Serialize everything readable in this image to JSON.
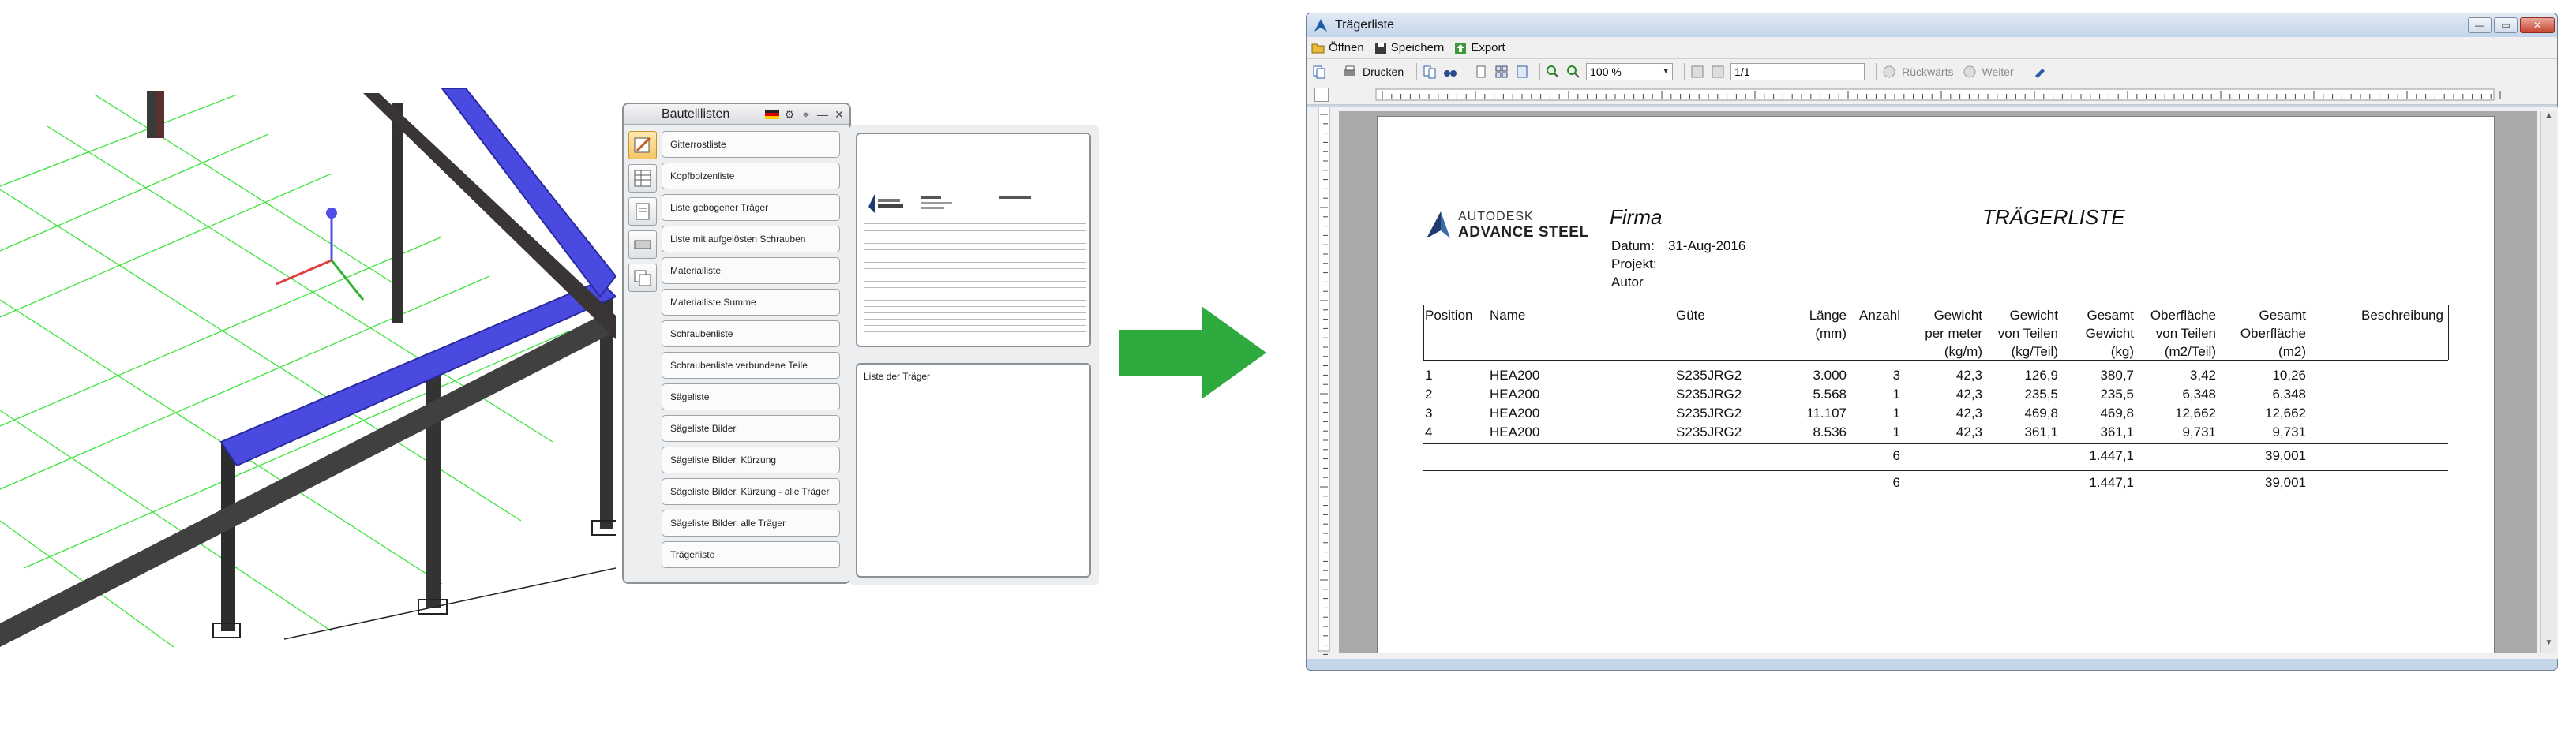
{
  "palette": {
    "title": "Bauteillisten",
    "items": [
      "Gitterrostliste",
      "Kopfbolzenliste",
      "Liste gebogener Träger",
      "Liste mit aufgelösten Schrauben",
      "Materialliste",
      "Materialliste Summe",
      "Schraubenliste",
      "Schraubenliste verbundene Teile",
      "Sägeliste",
      "Sägeliste Bilder",
      "Sägeliste Bilder, Kürzung",
      "Sägeliste Bilder, Kürzung - alle Träger",
      "Sägeliste Bilder, alle Träger",
      "Trägerliste"
    ],
    "description_title": "Liste der Träger"
  },
  "window": {
    "title": "Trägerliste",
    "menu": {
      "open": "Öffnen",
      "save": "Speichern",
      "export": "Export"
    },
    "toolbar": {
      "print": "Drucken",
      "zoom": "100 %",
      "page": "1/1",
      "back": "Rückwärts",
      "forward": "Weiter"
    }
  },
  "report": {
    "logo_line1": "AUTODESK",
    "logo_line2": "ADVANCE STEEL",
    "firma": "Firma",
    "title": "TRÄGERLISTE",
    "datum_label": "Datum:",
    "datum_value": "31-Aug-2016",
    "projekt_label": "Projekt:",
    "autor_label": "Autor",
    "columns": {
      "position": "Position",
      "name": "Name",
      "guete": "Güte",
      "laenge": [
        "Länge",
        "(mm)"
      ],
      "anzahl": "Anzahl",
      "gewicht_m": [
        "Gewicht",
        "per meter",
        "(kg/m)"
      ],
      "gewicht_teil": [
        "Gewicht",
        "von Teilen",
        "(kg/Teil)"
      ],
      "gesamt_gewicht": [
        "Gesamt",
        "Gewicht",
        "(kg)"
      ],
      "oberflaeche": [
        "Oberfläche",
        "von Teilen",
        "(m2/Teil)"
      ],
      "gesamt_oberflaeche": [
        "Gesamt",
        "Oberfläche",
        "(m2)"
      ],
      "beschreibung": "Beschreibung"
    },
    "rows": [
      [
        "1",
        "HEA200",
        "S235JRG2",
        "3.000",
        "3",
        "42,3",
        "126,9",
        "380,7",
        "3,42",
        "10,26"
      ],
      [
        "2",
        "HEA200",
        "S235JRG2",
        "5.568",
        "1",
        "42,3",
        "235,5",
        "235,5",
        "6,348",
        "6,348"
      ],
      [
        "3",
        "HEA200",
        "S235JRG2",
        "11.107",
        "1",
        "42,3",
        "469,8",
        "469,8",
        "12,662",
        "12,662"
      ],
      [
        "4",
        "HEA200",
        "S235JRG2",
        "8.536",
        "1",
        "42,3",
        "361,1",
        "361,1",
        "9,731",
        "9,731"
      ]
    ],
    "subtotal": {
      "anzahl": "6",
      "gewicht": "1.447,1",
      "oberflaeche": "39,001"
    },
    "total": {
      "anzahl": "6",
      "gewicht": "1.447,1",
      "oberflaeche": "39,001"
    }
  },
  "colors": {
    "arrow": "#2eaa3e",
    "grid": "#33dd33",
    "beam_highlight": "#4a4ae0",
    "steel": "#3a3a3a"
  }
}
